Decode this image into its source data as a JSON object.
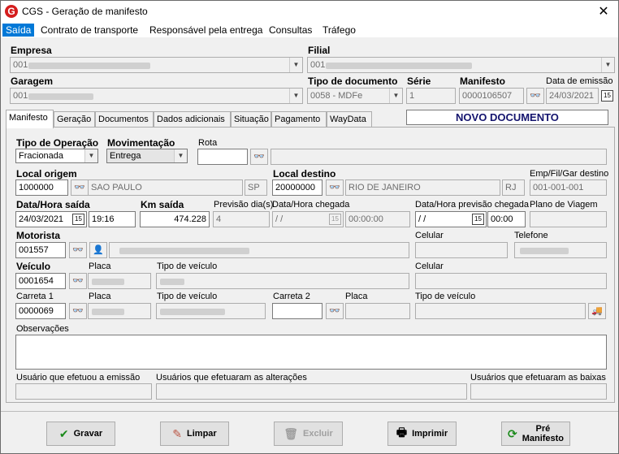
{
  "window": {
    "title": "CGS - Geração de manifesto"
  },
  "menu": [
    "Saída",
    "Contrato de transporte",
    "Responsável pela entrega",
    "Consultas",
    "Tráfego"
  ],
  "header": {
    "empresa_label": "Empresa",
    "empresa_value": "001",
    "filial_label": "Filial",
    "filial_value": "001",
    "garagem_label": "Garagem",
    "garagem_value": "001",
    "tipo_doc_label": "Tipo de documento",
    "tipo_doc_value": "0058 - MDFe",
    "serie_label": "Série",
    "serie_value": "1",
    "manifesto_label": "Manifesto",
    "manifesto_value": "0000106507",
    "data_emissao_label": "Data de emissão",
    "data_emissao_value": "24/03/2021"
  },
  "tabs": [
    "Manifesto",
    "Geração",
    "Documentos",
    "Dados adicionais",
    "Situação",
    "Pagamento",
    "WayData"
  ],
  "status": "NOVO DOCUMENTO",
  "form": {
    "tipo_op_label": "Tipo de Operação",
    "tipo_op_value": "Fracionada",
    "mov_label": "Movimentação",
    "mov_value": "Entrega",
    "rota_label": "Rota",
    "local_origem_label": "Local origem",
    "origem_code": "1000000",
    "origem_city": "SAO PAULO",
    "origem_uf": "SP",
    "local_destino_label": "Local destino",
    "destino_code": "20000000",
    "destino_city": "RIO DE JANEIRO",
    "destino_uf": "RJ",
    "empfil_label": "Emp/Fil/Gar destino",
    "empfil_value": "001-001-001",
    "data_saida_label": "Data/Hora saída",
    "data_saida": "24/03/2021",
    "hora_saida": "19:16",
    "km_label": "Km saída",
    "km_value": "474.228",
    "previsao_label": "Previsão dia(s)",
    "previsao_value": "4",
    "chegada_label": "Data/Hora chegada",
    "chegada_date": " / /",
    "chegada_time": "00:00:00",
    "prev_chegada_label": "Data/Hora previsão chegada",
    "prev_chegada_date": " / /",
    "prev_chegada_time": "00:00",
    "plano_label": "Plano de Viagem",
    "motorista_label": "Motorista",
    "motorista_code": "001557",
    "celular_label": "Celular",
    "telefone_label": "Telefone",
    "veiculo_label": "Veículo",
    "veiculo_code": "0001654",
    "placa_label": "Placa",
    "tipo_veiculo_label": "Tipo de veículo",
    "celular2_label": "Celular",
    "carreta1_label": "Carreta 1",
    "carreta1_code": "0000069",
    "placa2_label": "Placa",
    "tipo_veiculo2_label": "Tipo de veículo",
    "carreta2_label": "Carreta 2",
    "placa3_label": "Placa",
    "tipo_veiculo3_label": "Tipo de veículo",
    "obs_label": "Observações",
    "usuario_emissao_label": "Usuário que efetuou a emissão",
    "usuarios_alt_label": "Usuários que efetuaram as alterações",
    "usuarios_baixas_label": "Usuários que efetuaram as baixas"
  },
  "buttons": {
    "gravar": "Gravar",
    "limpar": "Limpar",
    "excluir": "Excluir",
    "imprimir": "Imprimir",
    "pre1": "Pré",
    "pre2": "Manifesto"
  }
}
